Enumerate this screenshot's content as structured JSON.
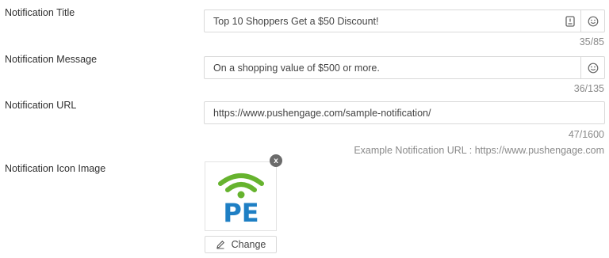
{
  "title_field": {
    "label": "Notification Title",
    "value": "Top 10 Shoppers Get a $50 Discount!",
    "counter": "35/85"
  },
  "message_field": {
    "label": "Notification Message",
    "value": "On a shopping value of $500 or more.",
    "counter": "36/135"
  },
  "url_field": {
    "label": "Notification URL",
    "value": "https://www.pushengage.com/sample-notification/",
    "counter": "47/1600",
    "hint": "Example Notification URL : https://www.pushengage.com"
  },
  "icon_image": {
    "label": "Notification Icon Image",
    "logo_text": "PE",
    "remove_glyph": "x",
    "change_label": "Change",
    "logo_colors": {
      "signal": "#66b32e",
      "letters": "#1e7fc4"
    }
  },
  "icons": [
    "text-format-icon",
    "emoji-icon",
    "close-icon",
    "pencil-icon"
  ]
}
